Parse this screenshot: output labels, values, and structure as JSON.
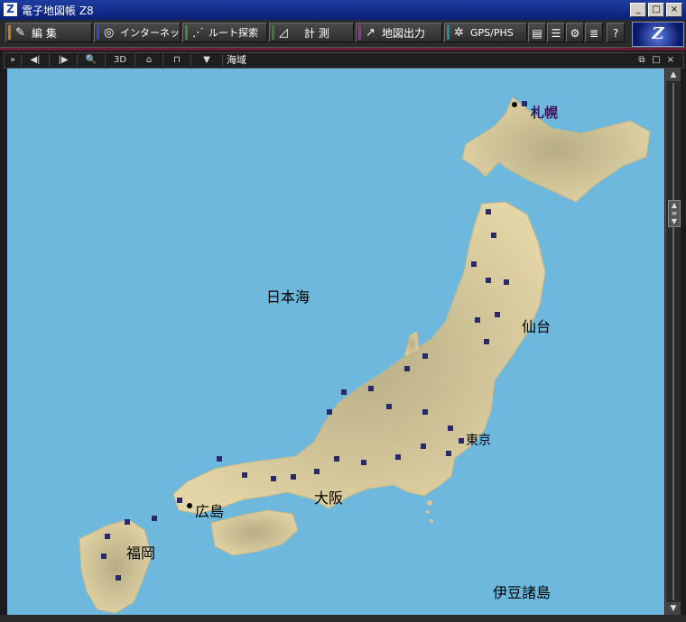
{
  "window": {
    "title": "電子地図帳 Z8",
    "icon_letter": "Z",
    "minimize": "_",
    "maximize": "□",
    "close": "×"
  },
  "toolbar": {
    "edit": "編 集",
    "internet": "インターネット",
    "route": "ルート探索",
    "measure": "計 測",
    "map_output": "地図出力",
    "gps": "GPS/PHS",
    "help": "?",
    "logo": "Z"
  },
  "navbar": {
    "expand": "»",
    "back": "◀|",
    "forward": "|▶",
    "zoom": "🔍",
    "view3d": "3D",
    "home": "⌂",
    "mark": "⊓",
    "dropdown": "▼",
    "location": "海域"
  },
  "map": {
    "sea_color": "#6db8dc",
    "land_color": "#d8c79a",
    "labels": {
      "sapporo": "札幌",
      "sea_of_japan": "日本海",
      "sendai": "仙台",
      "tokyo": "東京",
      "osaka": "大阪",
      "hiroshima": "広島",
      "fukuoka": "福岡",
      "izu": "伊豆諸島"
    }
  }
}
